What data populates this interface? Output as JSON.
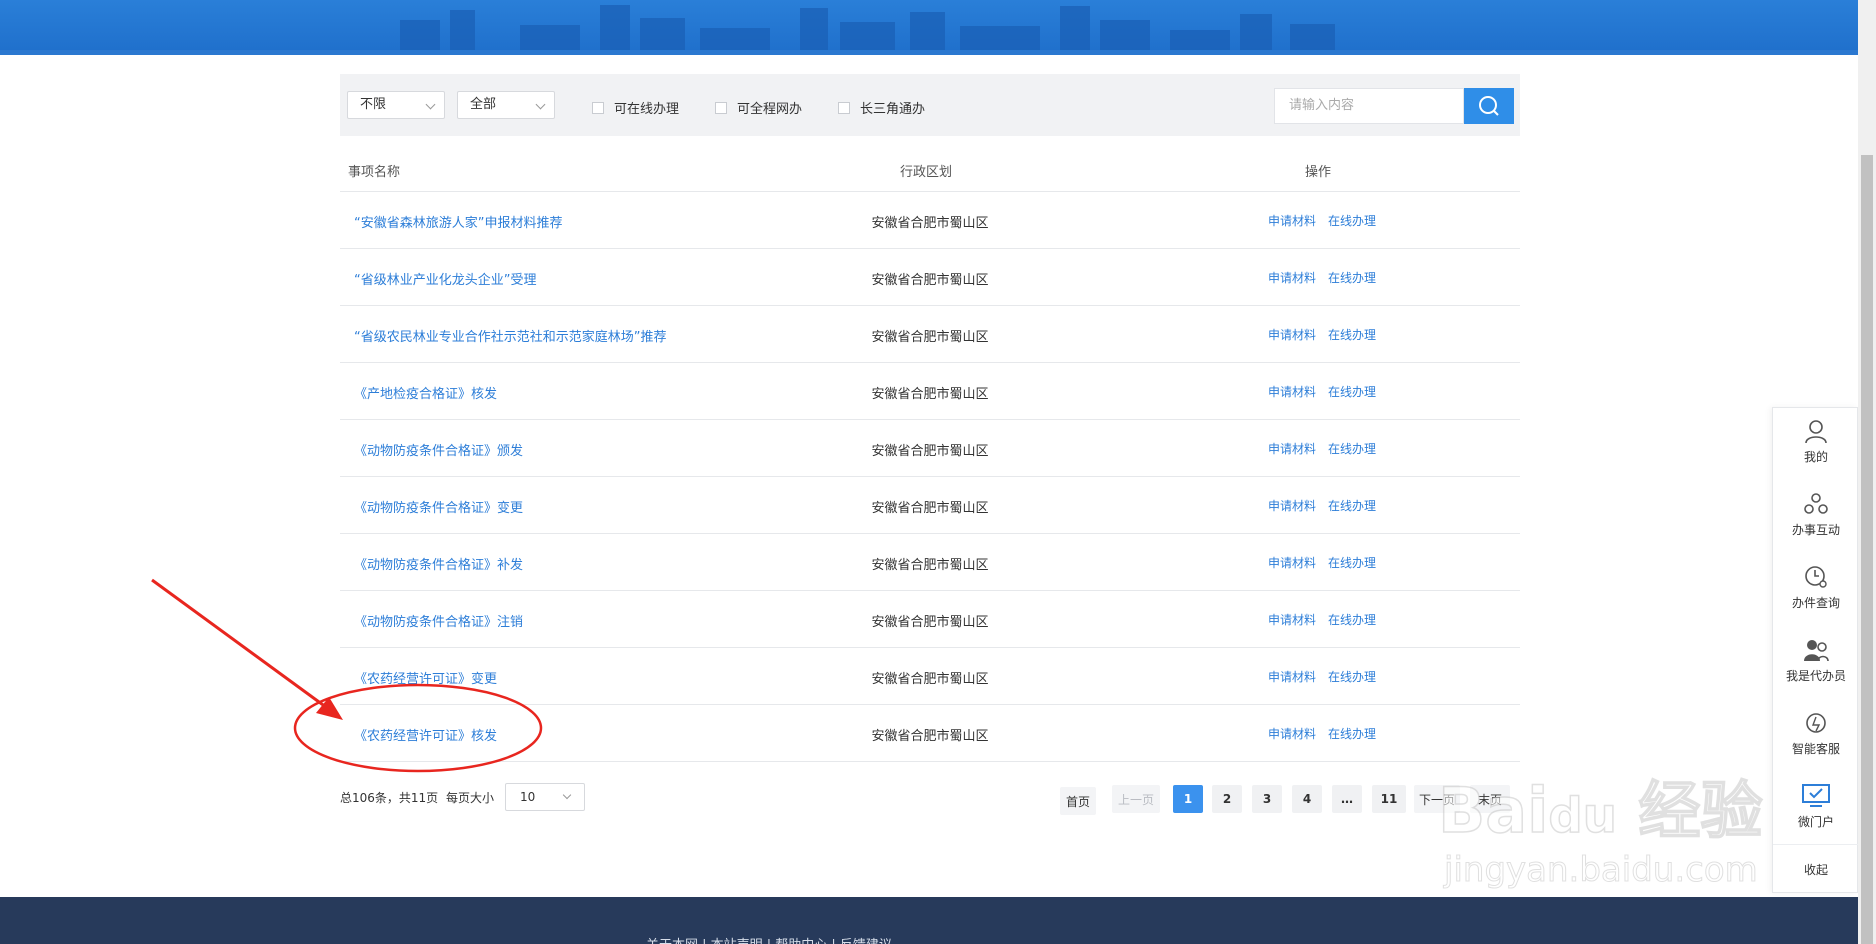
{
  "filters": {
    "select1": "不限",
    "select2": "全部",
    "checkboxes": [
      "可在线办理",
      "可全程网办",
      "长三角通办"
    ],
    "search_placeholder": "请输入内容"
  },
  "table": {
    "headers": [
      "事项名称",
      "行政区划",
      "操作"
    ],
    "rows": [
      {
        "name": "“安徽省森林旅游人家”申报材料推荐",
        "region": "安徽省合肥市蜀山区",
        "op1": "申请材料",
        "op2": "在线办理"
      },
      {
        "name": "“省级林业产业化龙头企业”受理",
        "region": "安徽省合肥市蜀山区",
        "op1": "申请材料",
        "op2": "在线办理"
      },
      {
        "name": "“省级农民林业专业合作社示范社和示范家庭林场”推荐",
        "region": "安徽省合肥市蜀山区",
        "op1": "申请材料",
        "op2": "在线办理"
      },
      {
        "name": "《产地检疫合格证》核发",
        "region": "安徽省合肥市蜀山区",
        "op1": "申请材料",
        "op2": "在线办理"
      },
      {
        "name": "《动物防疫条件合格证》颁发",
        "region": "安徽省合肥市蜀山区",
        "op1": "申请材料",
        "op2": "在线办理"
      },
      {
        "name": "《动物防疫条件合格证》变更",
        "region": "安徽省合肥市蜀山区",
        "op1": "申请材料",
        "op2": "在线办理"
      },
      {
        "name": "《动物防疫条件合格证》补发",
        "region": "安徽省合肥市蜀山区",
        "op1": "申请材料",
        "op2": "在线办理"
      },
      {
        "name": "《动物防疫条件合格证》注销",
        "region": "安徽省合肥市蜀山区",
        "op1": "申请材料",
        "op2": "在线办理"
      },
      {
        "name": "《农药经营许可证》变更",
        "region": "安徽省合肥市蜀山区",
        "op1": "申请材料",
        "op2": "在线办理"
      },
      {
        "name": "《农药经营许可证》核发",
        "region": "安徽省合肥市蜀山区",
        "op1": "申请材料",
        "op2": "在线办理"
      }
    ]
  },
  "pagination": {
    "summary": "总106条，共11页",
    "page_size_label": "每页大小",
    "page_size": "10",
    "first": "首页",
    "prev": "上一页",
    "pages": [
      "1",
      "2",
      "3",
      "4",
      "…",
      "11"
    ],
    "current": "1",
    "next": "下一页",
    "last": "末页"
  },
  "side_panel": {
    "items": [
      {
        "label": "我的",
        "icon": "user-icon"
      },
      {
        "label": "办事互动",
        "icon": "interaction-icon"
      },
      {
        "label": "办件查询",
        "icon": "clock-search-icon"
      },
      {
        "label": "我是代办员",
        "icon": "agent-icon"
      },
      {
        "label": "智能客服",
        "icon": "robot-service-icon"
      },
      {
        "label": "微门户",
        "icon": "monitor-icon"
      }
    ],
    "collapse": "收起"
  },
  "footer": {
    "links": "关于本网  |  本站声明  |  帮助中心  |  反馈建议"
  },
  "watermark": {
    "brand": "Bai du 经验",
    "url": "jingyan.baidu.com"
  },
  "colors": {
    "link_blue": "#2d7ed8",
    "accent": "#3b92ee",
    "annotation_red": "#e8261f",
    "footer_bg": "#273a5b"
  }
}
